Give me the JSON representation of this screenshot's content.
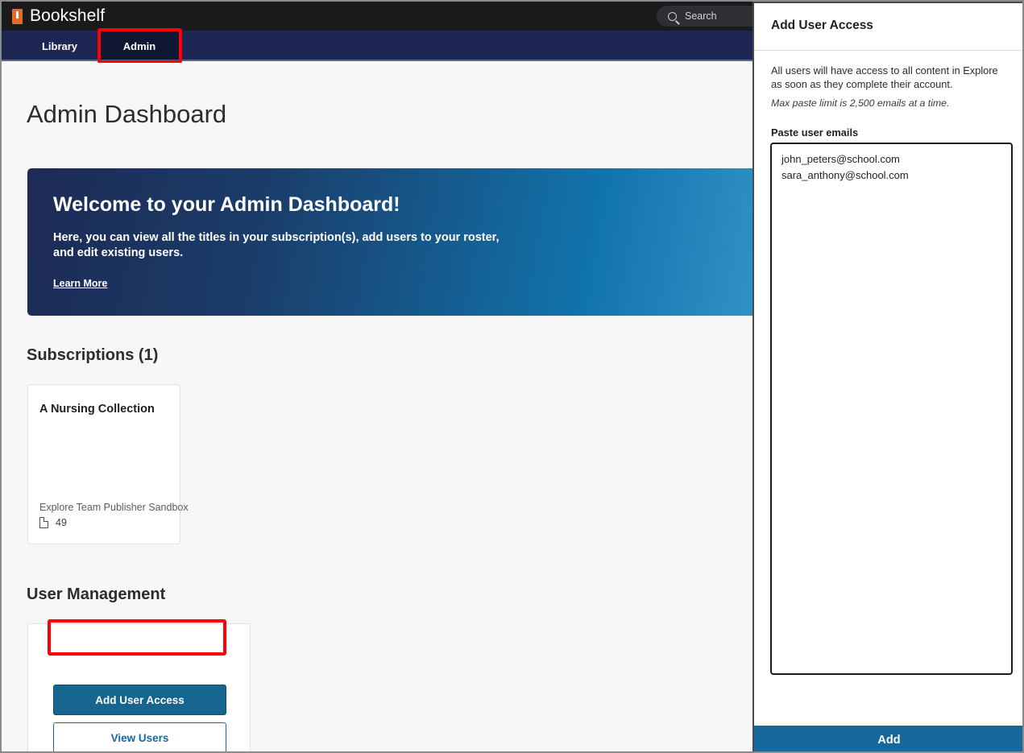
{
  "topbar": {
    "brand_name": "Bookshelf",
    "brand_icon": "book-icon",
    "search_placeholder": "Search",
    "search_value": "",
    "search_icon": "search-icon"
  },
  "nav": {
    "tabs": [
      {
        "label": "Library",
        "active": false
      },
      {
        "label": "Admin",
        "active": true
      }
    ]
  },
  "main": {
    "page_title": "Admin Dashboard",
    "banner": {
      "heading": "Welcome to your Admin Dashboard!",
      "body": "Here, you can view all the titles in your subscription(s), add users to your roster, and edit existing users.",
      "link_label": "Learn More"
    },
    "subscriptions": {
      "heading": "Subscriptions (1)",
      "cards": [
        {
          "title": "A Nursing Collection",
          "publisher": "Explore Team Publisher Sandbox",
          "count": "49",
          "count_icon": "document-icon"
        }
      ]
    },
    "user_management": {
      "heading": "User Management",
      "add_user_label": "Add User Access",
      "view_users_label": "View Users"
    }
  },
  "panel": {
    "title": "Add User Access",
    "description": "All users will have access to all content in Explore as soon as they complete their account.",
    "note": "Max paste limit is 2,500 emails at a time.",
    "field_label": "Paste user emails",
    "emails_value": "john_peters@school.com\nsara_anthony@school.com",
    "emails_placeholder": "",
    "submit_label": "Add"
  },
  "colors": {
    "topbar_bg": "#1a1a1c",
    "nav_bg": "#1e2754",
    "brand_orange": "#ec6724",
    "accent_blue": "#16679a",
    "link_blue": "#1766a6",
    "highlight_red": "#fb0007",
    "banner_gradient_start": "#1d2a55",
    "banner_gradient_end": "#49a2d4"
  }
}
